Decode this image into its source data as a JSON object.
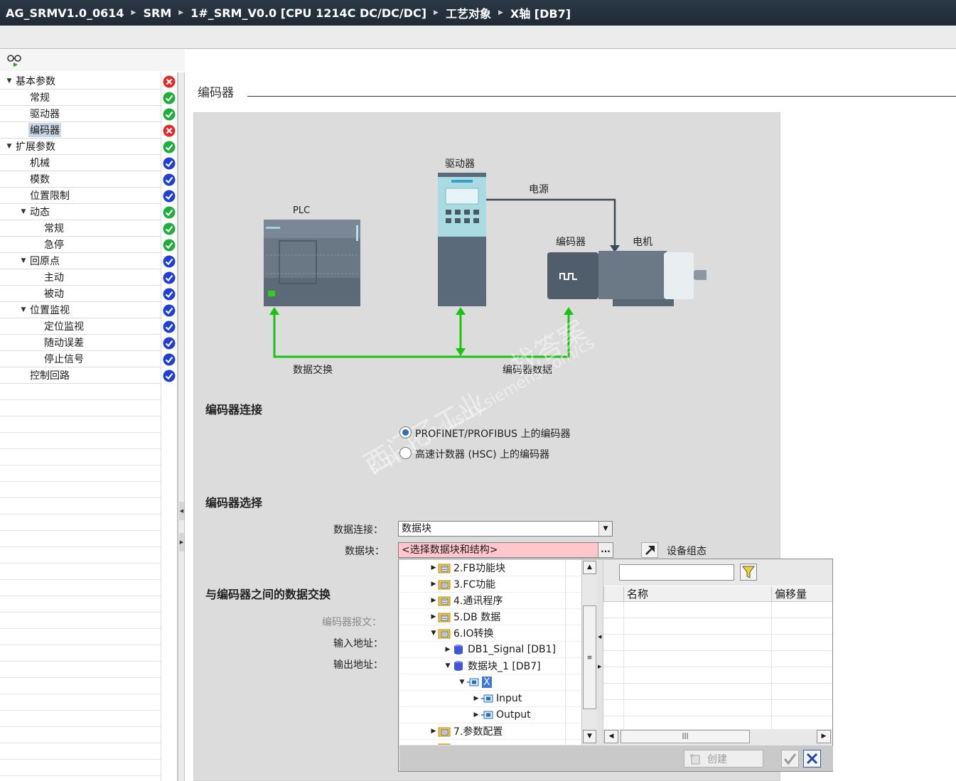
{
  "breadcrumb": [
    "AG_SRMV1.0_0614",
    "SRM",
    "1#_SRM_V0.0 [CPU 1214C DC/DC/DC]",
    "工艺对象",
    "X轴 [DB7]"
  ],
  "nav": {
    "items": [
      {
        "label": "基本参数",
        "status": "error",
        "expanded": true
      },
      {
        "label": "常规",
        "status": "ok"
      },
      {
        "label": "驱动器",
        "status": "ok"
      },
      {
        "label": "编码器",
        "status": "error",
        "selected": true
      },
      {
        "label": "扩展参数",
        "status": "ok",
        "expanded": true
      },
      {
        "label": "机械",
        "status": "blue"
      },
      {
        "label": "模数",
        "status": "blue"
      },
      {
        "label": "位置限制",
        "status": "blue"
      },
      {
        "label": "动态",
        "status": "ok",
        "expanded": true
      },
      {
        "label": "常规",
        "status": "ok"
      },
      {
        "label": "急停",
        "status": "ok"
      },
      {
        "label": "回原点",
        "status": "blue",
        "expanded": true
      },
      {
        "label": "主动",
        "status": "blue"
      },
      {
        "label": "被动",
        "status": "blue"
      },
      {
        "label": "位置监视",
        "status": "blue",
        "expanded": true
      },
      {
        "label": "定位监视",
        "status": "blue"
      },
      {
        "label": "随动误差",
        "status": "blue"
      },
      {
        "label": "停止信号",
        "status": "blue"
      },
      {
        "label": "控制回路",
        "status": "blue"
      }
    ]
  },
  "main": {
    "section_title": "编码器",
    "diagram": {
      "plc_label": "PLC",
      "drive_label": "驱动器",
      "power_label": "电源",
      "encoder_label": "编码器",
      "motor_label": "电机",
      "data_exchange_label": "数据交换",
      "encoder_data_label": "编码器数据",
      "colors": {
        "green": "#19c30f",
        "device": "#5a6a7a",
        "drive_top": "#a9dbe3"
      }
    },
    "connection": {
      "heading": "编码器连接",
      "options": [
        {
          "label": "PROFINET/PROFIBUS 上的编码器",
          "checked": true
        },
        {
          "label": "高速计数器 (HSC) 上的编码器",
          "checked": false
        }
      ]
    },
    "selection": {
      "heading": "编码器选择",
      "data_connection_label": "数据连接：",
      "data_connection_value": "数据块",
      "data_block_label": "数据块：",
      "data_block_value": "<选择数据块和结构>",
      "device_config_label": "设备组态"
    },
    "exchange": {
      "heading": "与编码器之间的数据交换",
      "telegram_label": "编码器报文：",
      "input_address_label": "输入地址：",
      "output_address_label": "输出地址："
    },
    "watermark": {
      "line1": "西门子工业",
      "line2": "找答案",
      "line3": "support.industry.siemens.com/cs"
    }
  },
  "popup": {
    "tree": [
      {
        "label": "2.FB功能块",
        "indent": 0,
        "type": "folder",
        "toggle": "collapsed"
      },
      {
        "label": "3.FC功能",
        "indent": 0,
        "type": "folder",
        "toggle": "collapsed"
      },
      {
        "label": "4.通讯程序",
        "indent": 0,
        "type": "folder",
        "toggle": "collapsed"
      },
      {
        "label": "5.DB 数据",
        "indent": 0,
        "type": "folder",
        "toggle": "collapsed"
      },
      {
        "label": "6.IO转换",
        "indent": 0,
        "type": "folder",
        "toggle": "expanded"
      },
      {
        "label": "DB1_Signal [DB1]",
        "indent": 1,
        "type": "db",
        "toggle": "collapsed"
      },
      {
        "label": "数据块_1 [DB7]",
        "indent": 1,
        "type": "db",
        "toggle": "expanded"
      },
      {
        "label": "X",
        "indent": 2,
        "type": "struct",
        "toggle": "expanded",
        "selected": true
      },
      {
        "label": "Input",
        "indent": 3,
        "type": "struct",
        "toggle": "collapsed"
      },
      {
        "label": "Output",
        "indent": 3,
        "type": "struct",
        "toggle": "collapsed"
      },
      {
        "label": "7.参数配置",
        "indent": 0,
        "type": "folder",
        "toggle": "collapsed"
      }
    ],
    "columns": {
      "name": "名称",
      "offset": "偏移量"
    },
    "create_label": "创建"
  }
}
